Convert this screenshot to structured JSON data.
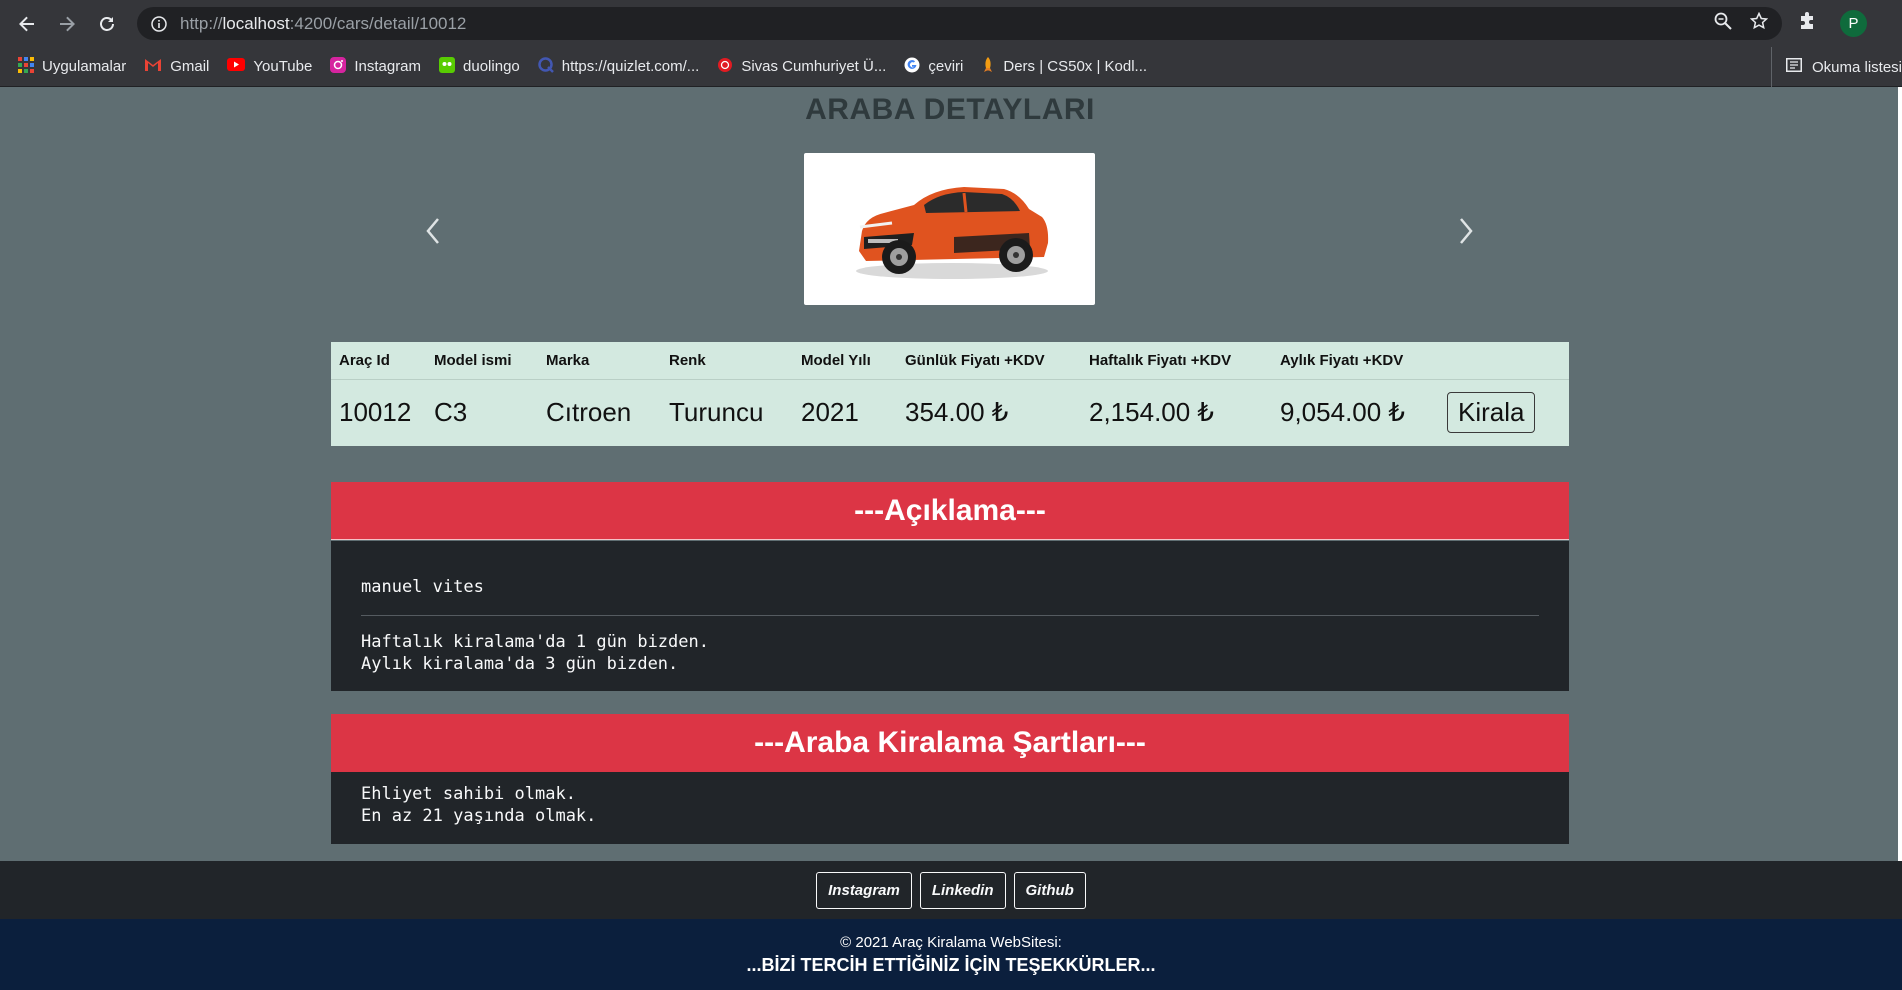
{
  "browser": {
    "url_prefix": "http://",
    "url_host": "localhost",
    "url_path": ":4200/cars/detail/10012",
    "profile_initial": "P",
    "bookmarks": [
      {
        "label": "Uygulamalar",
        "color": "#e8453c"
      },
      {
        "label": "Gmail",
        "color": "#ea4335"
      },
      {
        "label": "YouTube",
        "color": "#ff0000"
      },
      {
        "label": "Instagram",
        "color": "#d6249f"
      },
      {
        "label": "duolingo",
        "color": "#58cc02"
      },
      {
        "label": "https://quizlet.com/...",
        "color": "#4257b2"
      },
      {
        "label": "Sivas Cumhuriyet Ü...",
        "color": "#e11b22"
      },
      {
        "label": "çeviri",
        "color": "#4285f4"
      },
      {
        "label": "Ders | CS50x | Kodl...",
        "color": "#f39c12"
      }
    ],
    "reading_list": "Okuma listesi"
  },
  "page": {
    "title": "ARABA DETAYLARI",
    "table": {
      "headers": [
        "Araç Id",
        "Model ismi",
        "Marka",
        "Renk",
        "Model Yılı",
        "Günlük Fiyatı +KDV",
        "Haftalık Fiyatı +KDV",
        "Aylık Fiyatı +KDV"
      ],
      "row": [
        "10012",
        "C3",
        "Cıtroen",
        "Turuncu",
        "2021",
        "354.00 ₺",
        "2,154.00 ₺",
        "9,054.00 ₺"
      ],
      "rent_label": "Kirala"
    },
    "description": {
      "heading": "---Açıklama---",
      "text": "manuel vites",
      "line1": "Haftalık kiralama'da 1 gün bizden.",
      "line2": "Aylık kiralama'da 3 gün bizden."
    },
    "terms": {
      "heading": "---Araba Kiralama Şartları---",
      "line1": "Ehliyet sahibi olmak.",
      "line2": "En az 21 yaşında olmak."
    }
  },
  "footer": {
    "links": [
      "Instagram",
      "Linkedin",
      "Github"
    ],
    "copyright": "© 2021 Araç Kiralama WebSitesi:",
    "thanks": "...BİZİ TERCİH ETTİĞİNİZ İÇİN TEŞEKKÜRLER..."
  },
  "colors": {
    "accent_red": "#dc3545",
    "dark_panel": "#212529",
    "table_bg": "#d3e9e0",
    "page_bg": "#5f6e72",
    "car": "#e0531f"
  }
}
